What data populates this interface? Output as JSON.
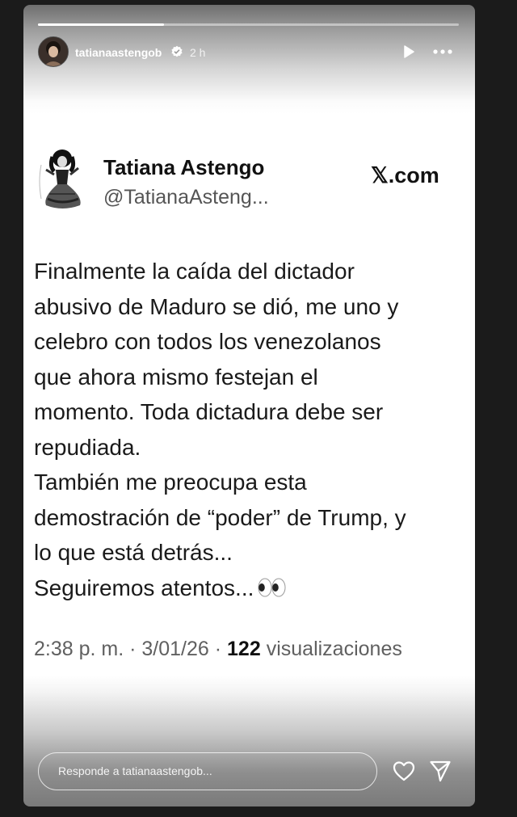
{
  "story": {
    "progress": 0.3,
    "username": "tatianaastengob",
    "time_ago": "2 h",
    "verified": true,
    "reply_placeholder": "Responde a tatianaastengob..."
  },
  "tweet": {
    "name": "Tatiana Astengo",
    "handle": "@TatianaAsteng...",
    "source": "𝕏.com",
    "lines": [
      "Finalmente la caída del dictador",
      "abusivo de Maduro se dió, me uno y",
      "celebro con todos los venezolanos",
      "que ahora mismo festejan el",
      "momento. Toda dictadura debe ser",
      "repudiada.",
      "También me preocupa esta",
      "demostración de “poder” de Trump, y",
      "lo que está detrás...",
      "Seguiremos atentos..."
    ],
    "time": "2:38 p. m.",
    "date": "3/01/26",
    "views_count": "122",
    "views_label": "visualizaciones"
  },
  "icons": {
    "verified": "verified-badge-icon",
    "play": "play-icon",
    "more": "more-icon",
    "eyes": "eyes-emoji-icon",
    "like": "heart-icon",
    "share": "send-icon"
  },
  "colors": {
    "background": "#1b1b1b",
    "tweet_text": "#1a1a1a",
    "tweet_secondary": "#606060"
  }
}
